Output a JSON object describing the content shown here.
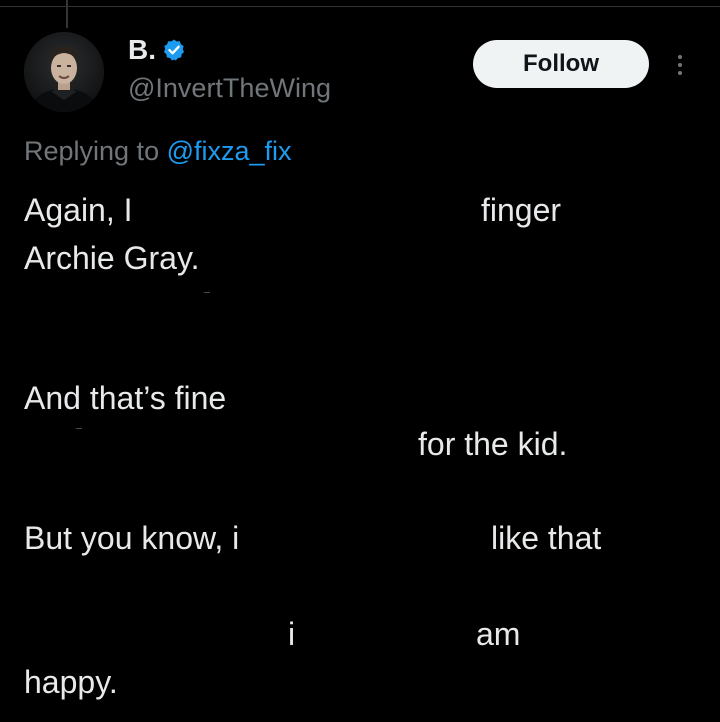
{
  "user": {
    "display_name": "B.",
    "handle": "@InvertTheWing",
    "verified": true,
    "avatar_icon": "avatar-photo"
  },
  "actions": {
    "follow_label": "Follow",
    "more_icon": "more-dots-icon"
  },
  "reply": {
    "prefix": "Replying to ",
    "handle": "@fixza_fix"
  },
  "tweet": {
    "fragments": [
      "Again, I",
      "finger",
      "Archie Gray.",
      "And that’s fine",
      "for the kid.",
      "But you know, i",
      "like that",
      "i",
      "am",
      "happy."
    ]
  },
  "colors": {
    "background": "#000000",
    "text": "#e7e9ea",
    "secondary_text": "#71767b",
    "link": "#1d9bf0",
    "verified_badge": "#1d9bf0",
    "follow_button_bg": "#eff3f4",
    "follow_button_text": "#0f1419"
  }
}
